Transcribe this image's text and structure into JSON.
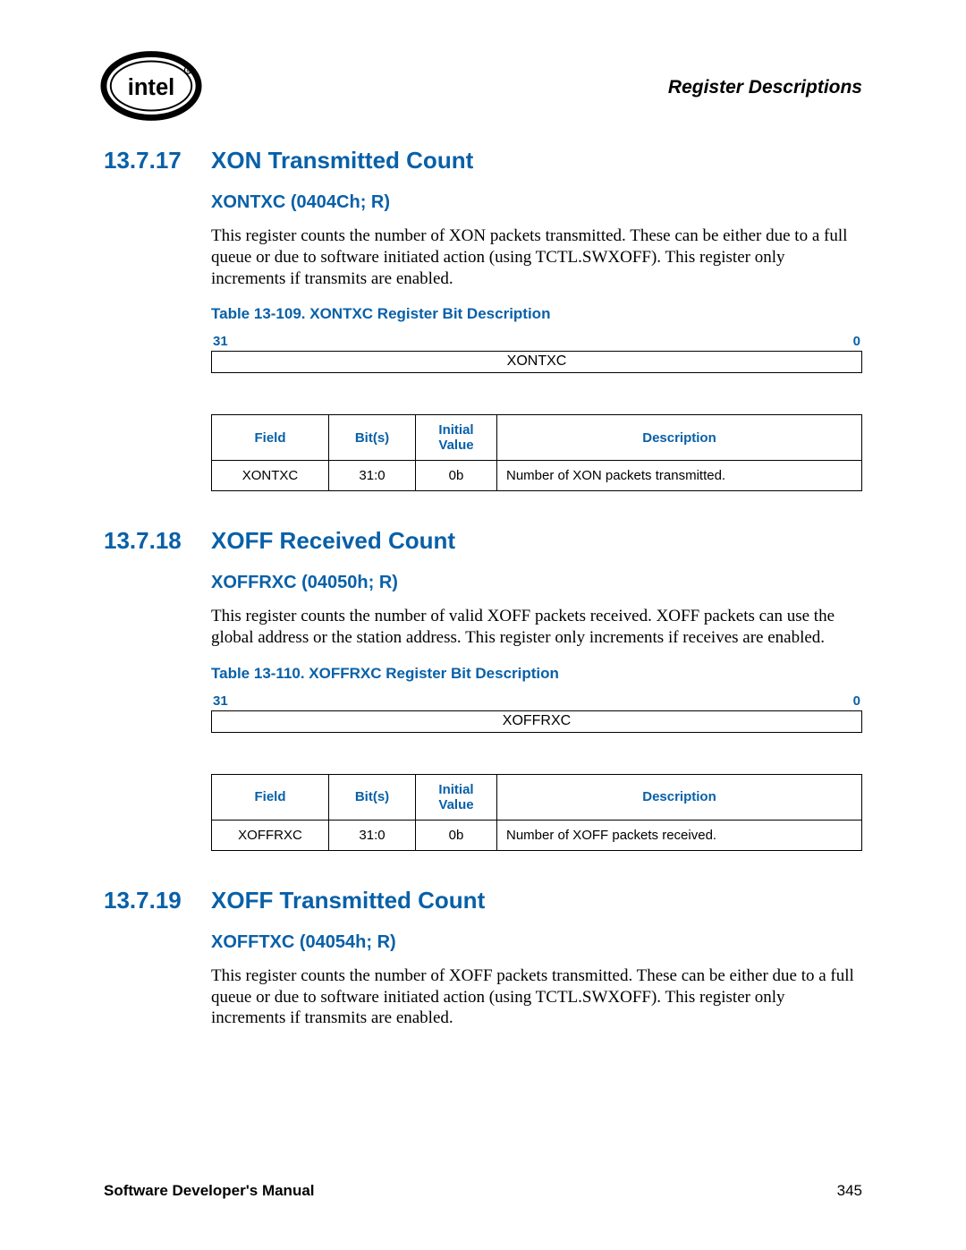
{
  "header": {
    "title": "Register Descriptions"
  },
  "sections": [
    {
      "number": "13.7.17",
      "title": "XON Transmitted Count",
      "register": "XONTXC (0404Ch; R)",
      "body": "This register counts the number of XON packets transmitted. These can be either due to a full queue or due to software initiated action (using TCTL.SWXOFF). This register only increments if transmits are enabled.",
      "table_caption": "Table 13-109. XONTXC Register Bit Description",
      "bit_high": "31",
      "bit_low": "0",
      "bit_field": "XONTXC",
      "columns": {
        "field": "Field",
        "bits": "Bit(s)",
        "initial": "Initial Value",
        "desc": "Description"
      },
      "rows": [
        {
          "field": "XONTXC",
          "bits": "31:0",
          "initial": "0b",
          "desc": "Number of XON packets transmitted."
        }
      ]
    },
    {
      "number": "13.7.18",
      "title": "XOFF Received Count",
      "register": "XOFFRXC (04050h; R)",
      "body": "This register counts the number of valid XOFF packets received. XOFF packets can use the global address or the station address. This register only increments if receives are enabled.",
      "table_caption": "Table 13-110. XOFFRXC Register Bit Description",
      "bit_high": "31",
      "bit_low": "0",
      "bit_field": "XOFFRXC",
      "columns": {
        "field": "Field",
        "bits": "Bit(s)",
        "initial": "Initial Value",
        "desc": "Description"
      },
      "rows": [
        {
          "field": "XOFFRXC",
          "bits": "31:0",
          "initial": "0b",
          "desc": "Number of XOFF packets received."
        }
      ]
    },
    {
      "number": "13.7.19",
      "title": "XOFF Transmitted Count",
      "register": "XOFFTXC (04054h; R)",
      "body": "This register counts the number of XOFF packets transmitted. These can be either due to a full queue or due to software initiated action (using TCTL.SWXOFF). This register only increments if transmits are enabled."
    }
  ],
  "footer": {
    "title": "Software Developer's Manual",
    "page": "345"
  }
}
